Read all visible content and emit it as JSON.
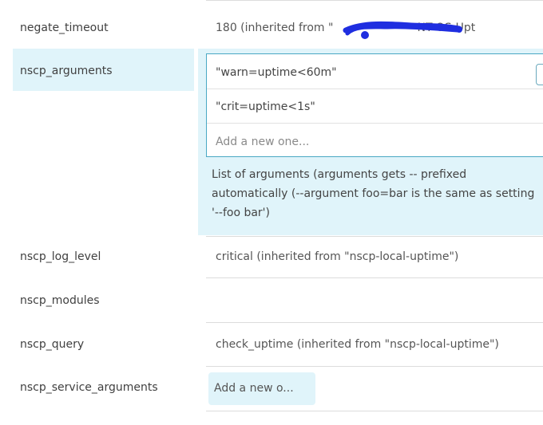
{
  "rows": {
    "negate_timeout": {
      "label": "negate_timeout",
      "value_prefix": "180  (inherited from \"",
      "value_suffix": "-NT-OS-Upt"
    },
    "nscp_arguments": {
      "label": "nscp_arguments",
      "items": [
        "\"warn=uptime<60m\"",
        "\"crit=uptime<1s\""
      ],
      "add_placeholder": "Add a new one...",
      "help_text": "List of arguments (arguments gets -- prefixed automatically (--argument foo=bar is the same as setting '--foo bar')"
    },
    "nscp_log_level": {
      "label": "nscp_log_level",
      "value": "critical  (inherited from \"nscp-local-uptime\")"
    },
    "nscp_modules": {
      "label": "nscp_modules",
      "value": ""
    },
    "nscp_query": {
      "label": "nscp_query",
      "value": "check_uptime  (inherited from \"nscp-local-uptime\")"
    },
    "nscp_service_arguments": {
      "label": "nscp_service_arguments",
      "add_placeholder": "Add a new o..."
    }
  },
  "colors": {
    "highlight": "#e0f4fa",
    "border_focus": "#4aa8c4",
    "redaction": "#1f2ee0"
  }
}
